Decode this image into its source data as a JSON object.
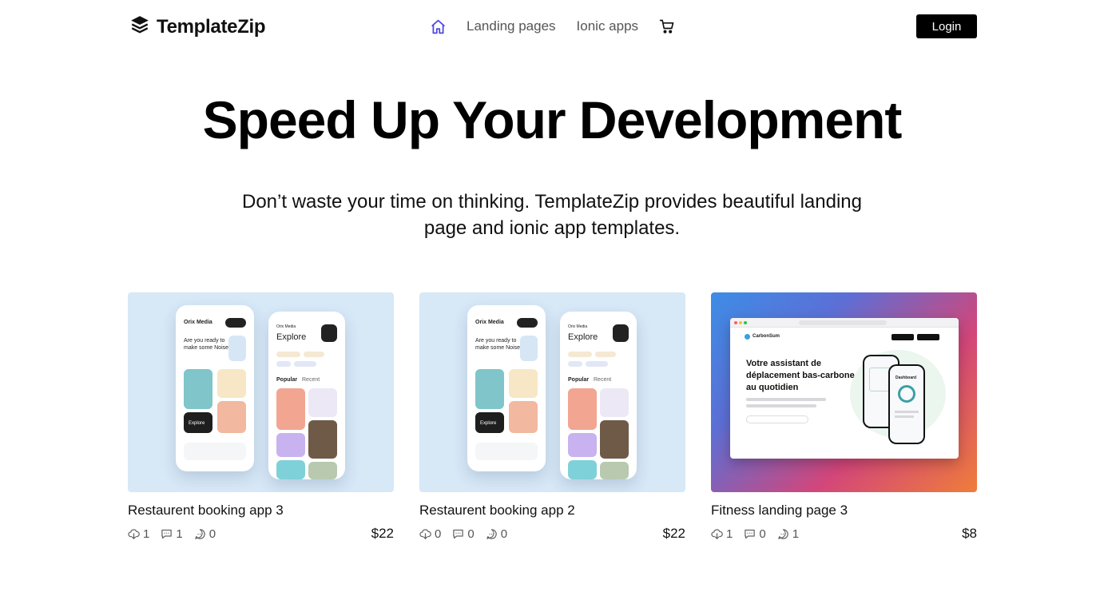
{
  "brand": {
    "name": "TemplateZip"
  },
  "nav": {
    "links": [
      "Landing pages",
      "Ionic apps"
    ],
    "login_label": "Login"
  },
  "hero": {
    "title": "Speed Up Your Development",
    "subtitle": "Don’t waste your time on thinking. TemplateZip provides beautiful landing page and ionic app templates."
  },
  "cards": [
    {
      "title": "Restaurent booking app 3",
      "downloads": "1",
      "comments": "1",
      "messages": "0",
      "price": "$22",
      "thumb": {
        "brand": "Orix Media",
        "explore": "Explore",
        "tagline": "Are you ready to make some Noise",
        "button": "Explore",
        "popular": "Popular",
        "recent": "Recent"
      }
    },
    {
      "title": "Restaurent booking app 2",
      "downloads": "0",
      "comments": "0",
      "messages": "0",
      "price": "$22",
      "thumb": {
        "brand": "Orix Media",
        "explore": "Explore",
        "tagline": "Are you ready to make some Noise",
        "button": "Explore",
        "popular": "Popular",
        "recent": "Recent"
      }
    },
    {
      "title": "Fitness landing page 3",
      "downloads": "1",
      "comments": "0",
      "messages": "1",
      "price": "$8",
      "thumb": {
        "brand": "CarbonSum",
        "headline": "Votre assistant de déplacement bas-carbone au quotidien",
        "dashboard": "Dashboard"
      }
    }
  ],
  "colors": {
    "accent": "#4f46e5",
    "login_bg": "#000000",
    "app_thumb_bg": "#d7e8f7"
  },
  "icons": [
    "layers-logo-icon",
    "home-icon",
    "cart-icon",
    "download-icon",
    "comment-icon",
    "message-icon"
  ]
}
